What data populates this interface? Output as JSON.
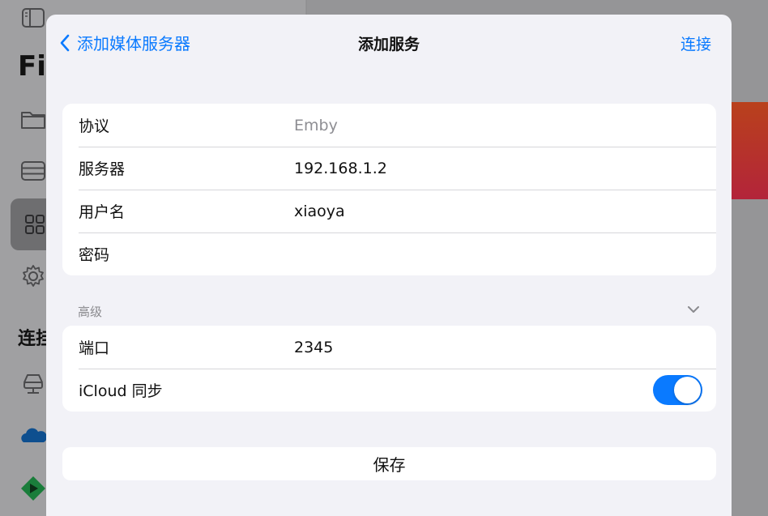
{
  "background_app": {
    "title_partial": "Fi",
    "section_partial": "连挂"
  },
  "sheet": {
    "back_label": "添加媒体服务器",
    "title": "添加服务",
    "action_label": "连接",
    "form": {
      "rows": [
        {
          "label": "协议",
          "value": "Emby",
          "value_is_placeholder": true
        },
        {
          "label": "服务器",
          "value": "192.168.1.2"
        },
        {
          "label": "用户名",
          "value": "xiaoya"
        },
        {
          "label": "密码",
          "value": ""
        }
      ]
    },
    "advanced": {
      "header": "高级",
      "expanded": true,
      "rows": [
        {
          "label": "端口",
          "value": "2345"
        },
        {
          "label": "iCloud 同步",
          "toggle_on": true
        }
      ]
    },
    "save_label": "保存"
  },
  "colors": {
    "accent": "#0a7aff",
    "sheet_background": "#f2f2f7",
    "card": "#ffffff",
    "placeholder_text": "#8e8e93"
  }
}
